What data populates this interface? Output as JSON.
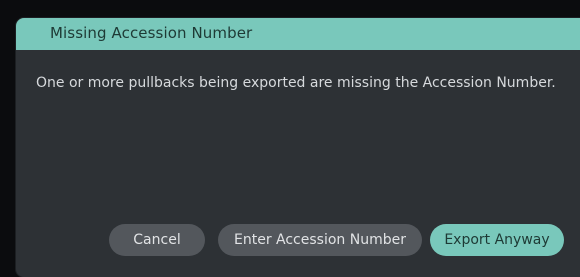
{
  "dialog": {
    "title": "Missing Accession Number",
    "message": "One or more pullbacks being exported are missing the Accession Number.",
    "buttons": {
      "cancel": "Cancel",
      "enter_accession": "Enter Accession Number",
      "export_anyway": "Export Anyway"
    }
  },
  "colors": {
    "header_accent": "#79c8bb",
    "dialog_background": "#2d3135",
    "secondary_button": "#53575c"
  }
}
